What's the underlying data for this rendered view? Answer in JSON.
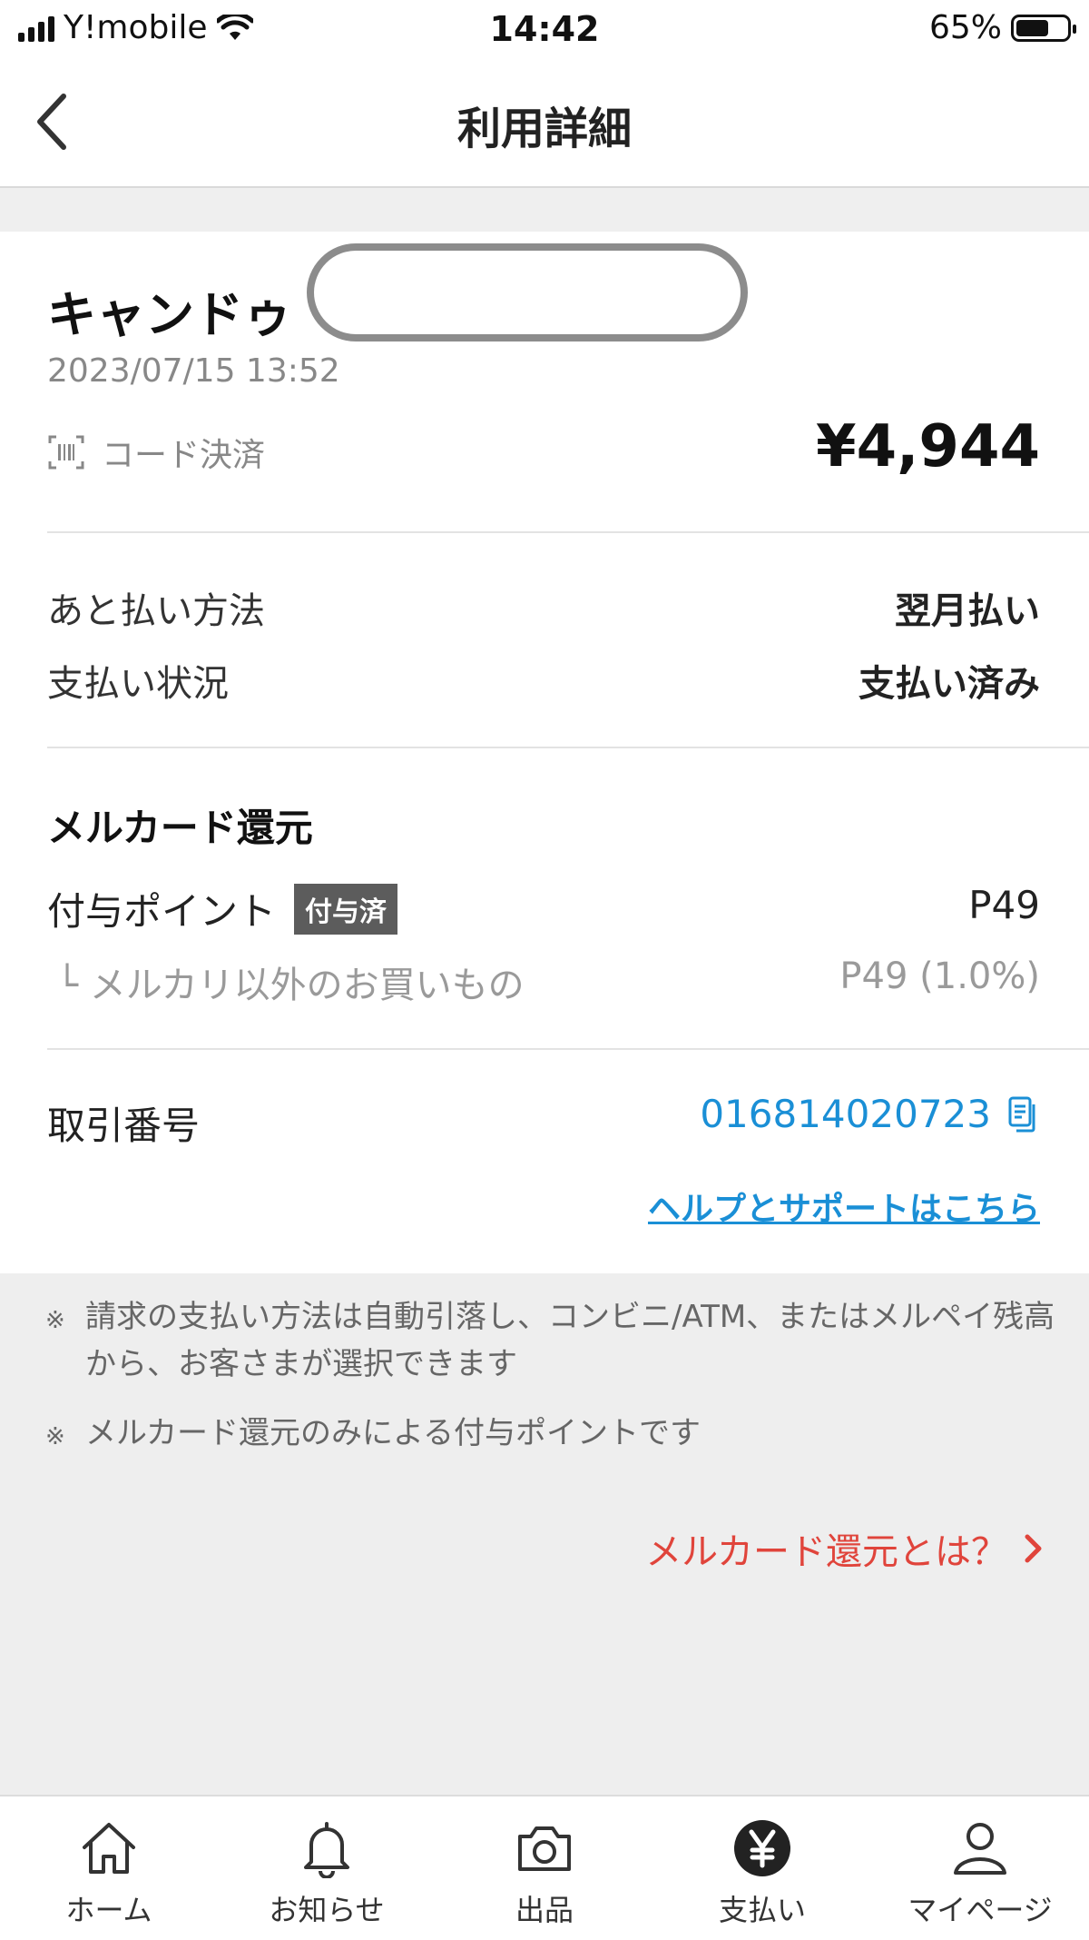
{
  "status_bar": {
    "carrier": "Y!mobile",
    "time": "14:42",
    "battery": "65%",
    "battery_level": 0.65
  },
  "header": {
    "title": "利用詳細",
    "back_icon": "chevron-left-icon"
  },
  "transaction": {
    "merchant": "キャンドゥ",
    "datetime": "2023/07/15 13:52",
    "payment_type": "コード決済",
    "amount": "¥4,944"
  },
  "details": {
    "method_label": "あと払い方法",
    "method_value": "翌月払い",
    "status_label": "支払い状況",
    "status_value": "支払い済み"
  },
  "rewards": {
    "title": "メルカード還元",
    "points_label": "付与ポイント",
    "badge": "付与済",
    "points_value": "P49",
    "sub_label": "└ メルカリ以外のお買いもの",
    "sub_value": "P49 (1.0%)"
  },
  "transaction_id": {
    "label": "取引番号",
    "value": "016814020723"
  },
  "help_link": "ヘルプとサポートはこちら",
  "notes": [
    "請求の支払い方法は自動引落し、コンビニ/ATM、またはメルペイ残高から、お客さまが選択できます",
    "メルカード還元のみによる付与ポイントです"
  ],
  "note_mark": "※",
  "rewards_link": "メルカード還元とは？",
  "bottom_nav": {
    "items": [
      {
        "label": "ホーム",
        "icon": "home-icon"
      },
      {
        "label": "お知らせ",
        "icon": "bell-icon"
      },
      {
        "label": "出品",
        "icon": "camera-icon"
      },
      {
        "label": "支払い",
        "icon": "yen-icon"
      },
      {
        "label": "マイページ",
        "icon": "person-icon"
      }
    ]
  },
  "colors": {
    "link_blue": "#1a8fd6",
    "accent_red": "#e0443b",
    "badge_grey": "#5c5c5c"
  }
}
